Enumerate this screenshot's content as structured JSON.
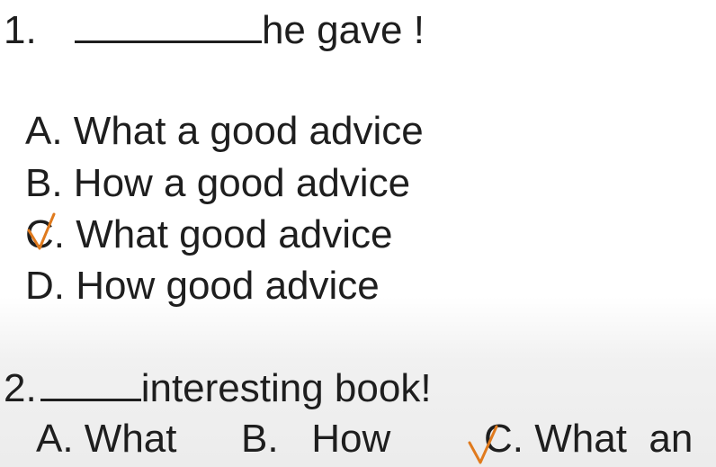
{
  "question1": {
    "number": "1.",
    "stem": "he gave !",
    "options": [
      {
        "letter": "A",
        "text": ". What a good advice"
      },
      {
        "letter": "B",
        "text": ". How a good advice"
      },
      {
        "letter": "C",
        "text": ". What good advice",
        "checked": true
      },
      {
        "letter": "D",
        "text": ". How good advice"
      }
    ]
  },
  "question2": {
    "number": "2.",
    "stem": "interesting book!",
    "options": [
      {
        "letter": "A",
        "text": ". What"
      },
      {
        "letter": "B",
        "text": ".   How"
      },
      {
        "letter": "C",
        "text": ". What  an",
        "checked": true
      }
    ]
  },
  "colors": {
    "text": "#1e1e1e",
    "checkmark": "#e07a1d"
  },
  "icons": {
    "checkmark": "handwritten-checkmark-icon"
  }
}
